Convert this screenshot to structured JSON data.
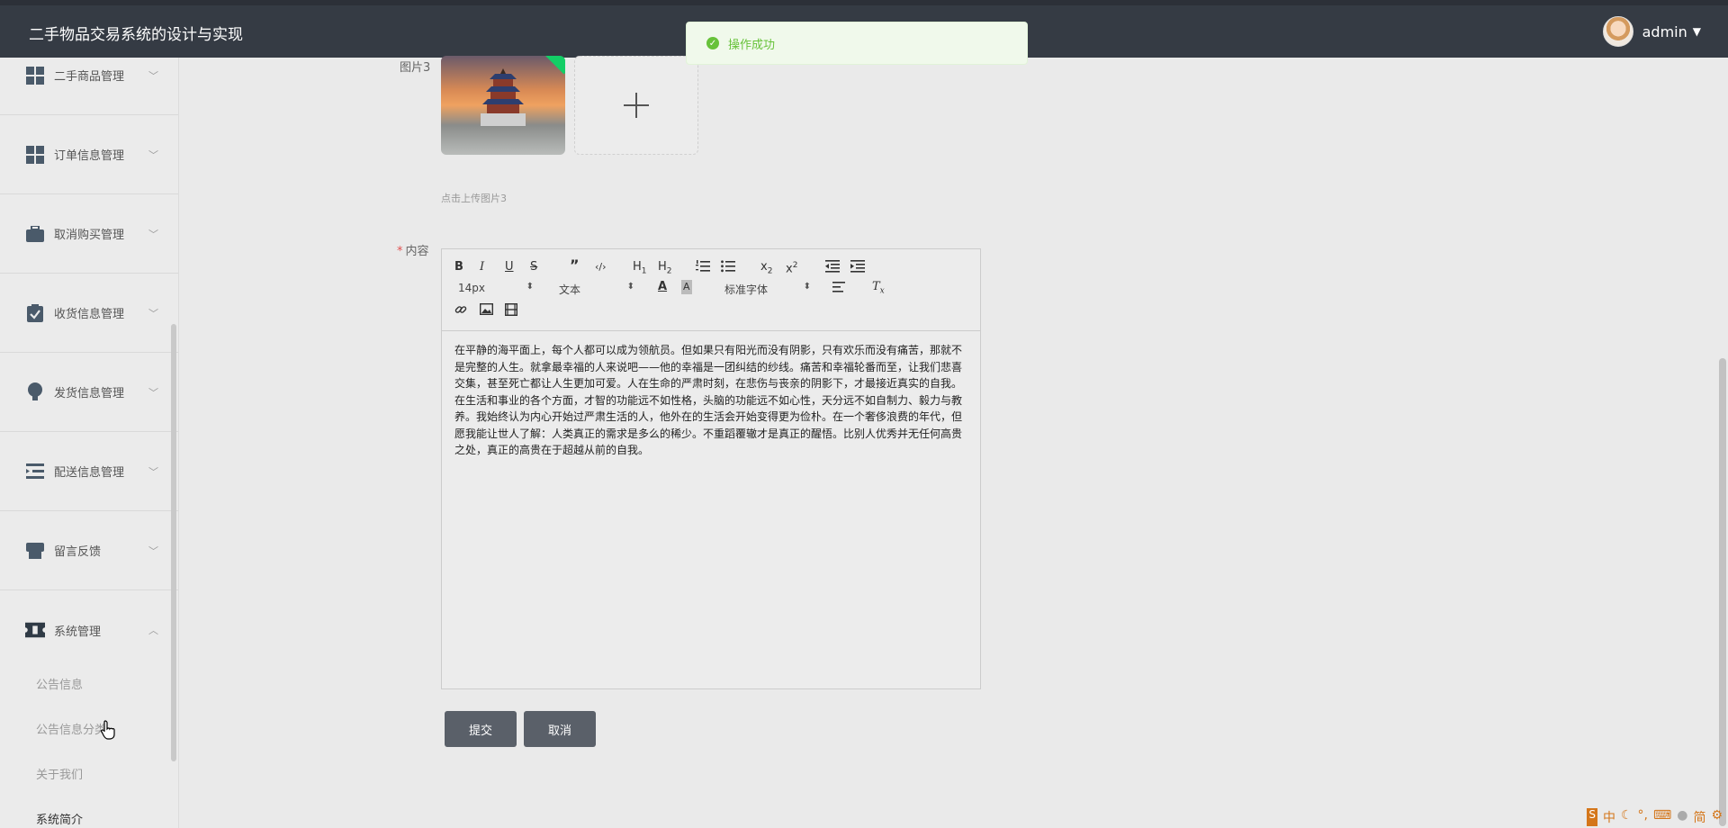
{
  "header": {
    "app_title": "二手物品交易系统的设计与实现",
    "username": "admin"
  },
  "toast": {
    "message": "操作成功"
  },
  "sidebar": {
    "items": [
      {
        "label": "二手商品管理"
      },
      {
        "label": "订单信息管理"
      },
      {
        "label": "取消购买管理"
      },
      {
        "label": "收货信息管理"
      },
      {
        "label": "发货信息管理"
      },
      {
        "label": "配送信息管理"
      },
      {
        "label": "留言反馈"
      },
      {
        "label": "系统管理"
      }
    ],
    "sub_items": [
      {
        "label": "公告信息"
      },
      {
        "label": "公告信息分类"
      },
      {
        "label": "关于我们"
      },
      {
        "label": "系统简介"
      }
    ]
  },
  "form": {
    "image3_label": "图片3",
    "image3_hint": "点击上传图片3",
    "content_required": "*",
    "content_label": "内容",
    "submit_label": "提交",
    "cancel_label": "取消"
  },
  "editor": {
    "font_size": "14px",
    "block_type": "文本",
    "font_family": "标准字体",
    "content": "在平静的海平面上，每个人都可以成为领航员。但如果只有阳光而没有阴影，只有欢乐而没有痛苦，那就不是完整的人生。就拿最幸福的人来说吧——他的幸福是一团纠结的纱线。痛苦和幸福轮番而至，让我们悲喜交集，甚至死亡都让人生更加可爱。人在生命的严肃时刻，在悲伤与丧亲的阴影下，才最接近真实的自我。在生活和事业的各个方面，才智的功能远不如性格，头脑的功能远不如心性，天分远不如自制力、毅力与教养。我始终认为内心开始过严肃生活的人，他外在的生活会开始变得更为俭朴。在一个奢侈浪费的年代，但愿我能让世人了解：人类真正的需求是多么的稀少。不重蹈覆辙才是真正的醒悟。比别人优秀并无任何高贵之处，真正的高贵在于超越从前的自我。"
  },
  "ime": {
    "chinese": "中",
    "simplified": "简"
  }
}
